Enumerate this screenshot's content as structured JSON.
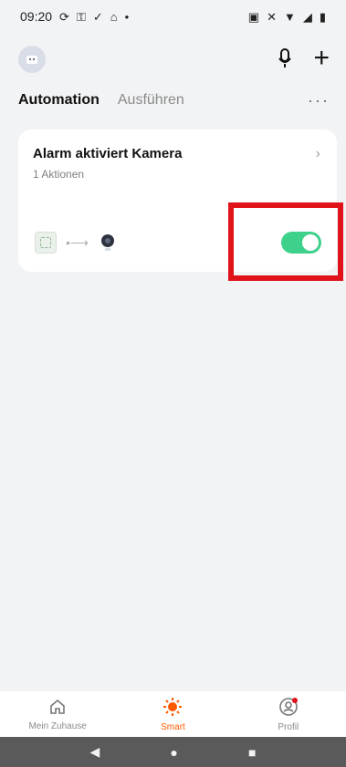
{
  "status": {
    "time": "09:20",
    "icons": [
      "sync-icon",
      "key-icon",
      "check-icon",
      "nfc-icon",
      "dot-icon",
      "nfc-right-icon",
      "mute-icon",
      "wifi-icon",
      "signal-icon",
      "battery-icon"
    ]
  },
  "header": {
    "avatar_icon": "robot-avatar-icon",
    "mic_icon": "mic-icon",
    "plus_label": "+"
  },
  "tabs": {
    "active": "Automation",
    "other": "Ausführen",
    "more": "···"
  },
  "automation": {
    "title": "Alarm aktiviert Kamera",
    "subtitle": "1 Aktionen",
    "chevron": "›",
    "flow": {
      "source_icon": "sensor-icon",
      "arrow": "•⟶",
      "target_icon": "camera-icon"
    },
    "enabled": true
  },
  "highlight_color": "#e0121a",
  "toggle_color": "#3ed18b",
  "bottom_nav": {
    "items": [
      {
        "label": "Mein Zuhause",
        "icon": "home-icon",
        "active": false
      },
      {
        "label": "Smart",
        "icon": "sun-icon",
        "active": true
      },
      {
        "label": "Profil",
        "icon": "profile-icon",
        "active": false
      }
    ]
  },
  "system_nav": {
    "back": "◀",
    "home": "●",
    "recents": "■"
  },
  "accent": "#ff5a00"
}
